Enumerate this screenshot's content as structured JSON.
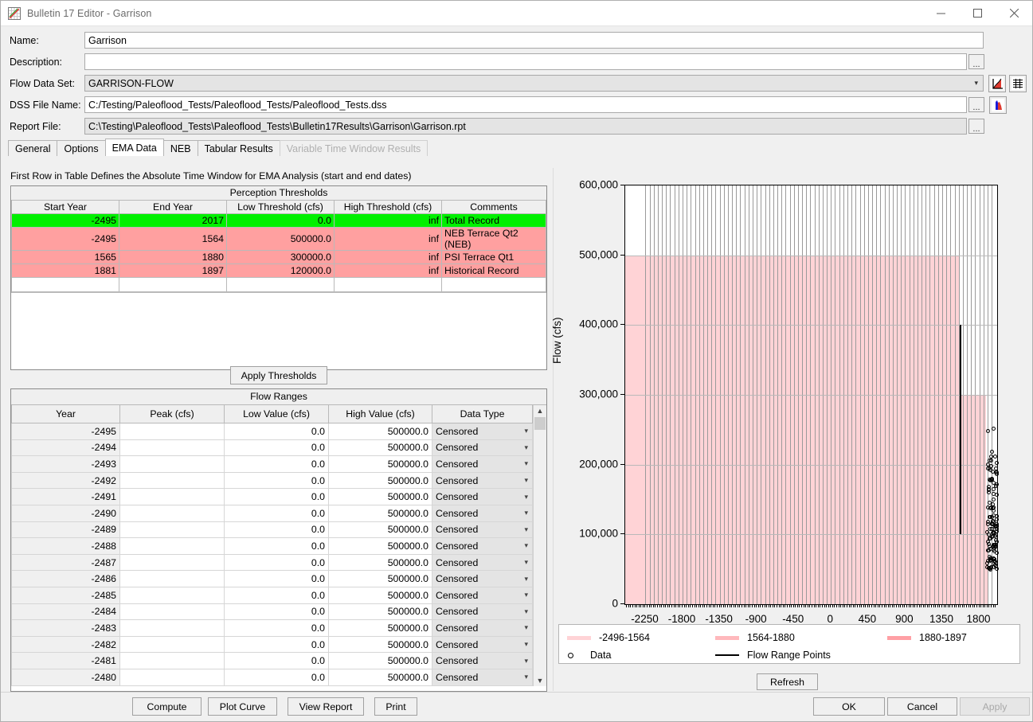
{
  "window": {
    "title": "Bulletin 17 Editor - Garrison",
    "icon": "bulletin-chart-icon",
    "minimize": "minimize-icon",
    "maximize": "maximize-icon",
    "close": "close-icon"
  },
  "form": {
    "name_label": "Name:",
    "name_value": "Garrison",
    "description_label": "Description:",
    "description_value": "",
    "flow_data_set_label": "Flow Data Set:",
    "flow_data_set_value": "GARRISON-FLOW",
    "dss_file_label": "DSS File Name:",
    "dss_file_value": "C:/Testing/Paleoflood_Tests/Paleoflood_Tests/Paleoflood_Tests.dss",
    "report_file_label": "Report File:",
    "report_file_value": "C:\\Testing\\Paleoflood_Tests\\Paleoflood_Tests\\Bulletin17Results\\Garrison\\Garrison.rpt",
    "ellipsis": "...",
    "icons": {
      "plot": "line-plot-icon",
      "table": "table-icon",
      "histogram": "histogram-icon"
    }
  },
  "tabs": [
    {
      "label": "General",
      "active": false,
      "disabled": false
    },
    {
      "label": "Options",
      "active": false,
      "disabled": false
    },
    {
      "label": "EMA Data",
      "active": true,
      "disabled": false
    },
    {
      "label": "NEB",
      "active": false,
      "disabled": false
    },
    {
      "label": "Tabular Results",
      "active": false,
      "disabled": false
    },
    {
      "label": "Variable Time Window Results",
      "active": false,
      "disabled": true
    }
  ],
  "hint": "First Row in Table Defines the Absolute Time Window for EMA Analysis (start and end dates)",
  "perception_thresholds": {
    "caption": "Perception Thresholds",
    "columns": [
      "Start Year",
      "End Year",
      "Low Threshold (cfs)",
      "High Threshold (cfs)",
      "Comments"
    ],
    "rows": [
      {
        "start": "-2495",
        "end": "2017",
        "low": "0.0",
        "high": "inf",
        "comment": "Total Record",
        "style": "green"
      },
      {
        "start": "-2495",
        "end": "1564",
        "low": "500000.0",
        "high": "inf",
        "comment": "NEB Terrace Qt2 (NEB)",
        "style": "pink"
      },
      {
        "start": "1565",
        "end": "1880",
        "low": "300000.0",
        "high": "inf",
        "comment": "PSI Terrace Qt1",
        "style": "pink"
      },
      {
        "start": "1881",
        "end": "1897",
        "low": "120000.0",
        "high": "inf",
        "comment": "Historical Record",
        "style": "pink"
      },
      {
        "start": "",
        "end": "",
        "low": "",
        "high": "",
        "comment": "",
        "style": "empty"
      }
    ]
  },
  "apply_thresholds_label": "Apply Thresholds",
  "flow_ranges": {
    "caption": "Flow Ranges",
    "columns": [
      "Year",
      "Peak (cfs)",
      "Low Value (cfs)",
      "High Value (cfs)",
      "Data Type"
    ],
    "rows": [
      {
        "year": "-2495",
        "peak": "",
        "low": "0.0",
        "high": "500000.0",
        "type": "Censored"
      },
      {
        "year": "-2494",
        "peak": "",
        "low": "0.0",
        "high": "500000.0",
        "type": "Censored"
      },
      {
        "year": "-2493",
        "peak": "",
        "low": "0.0",
        "high": "500000.0",
        "type": "Censored"
      },
      {
        "year": "-2492",
        "peak": "",
        "low": "0.0",
        "high": "500000.0",
        "type": "Censored"
      },
      {
        "year": "-2491",
        "peak": "",
        "low": "0.0",
        "high": "500000.0",
        "type": "Censored"
      },
      {
        "year": "-2490",
        "peak": "",
        "low": "0.0",
        "high": "500000.0",
        "type": "Censored"
      },
      {
        "year": "-2489",
        "peak": "",
        "low": "0.0",
        "high": "500000.0",
        "type": "Censored"
      },
      {
        "year": "-2488",
        "peak": "",
        "low": "0.0",
        "high": "500000.0",
        "type": "Censored"
      },
      {
        "year": "-2487",
        "peak": "",
        "low": "0.0",
        "high": "500000.0",
        "type": "Censored"
      },
      {
        "year": "-2486",
        "peak": "",
        "low": "0.0",
        "high": "500000.0",
        "type": "Censored"
      },
      {
        "year": "-2485",
        "peak": "",
        "low": "0.0",
        "high": "500000.0",
        "type": "Censored"
      },
      {
        "year": "-2484",
        "peak": "",
        "low": "0.0",
        "high": "500000.0",
        "type": "Censored"
      },
      {
        "year": "-2483",
        "peak": "",
        "low": "0.0",
        "high": "500000.0",
        "type": "Censored"
      },
      {
        "year": "-2482",
        "peak": "",
        "low": "0.0",
        "high": "500000.0",
        "type": "Censored"
      },
      {
        "year": "-2481",
        "peak": "",
        "low": "0.0",
        "high": "500000.0",
        "type": "Censored"
      },
      {
        "year": "-2480",
        "peak": "",
        "low": "0.0",
        "high": "500000.0",
        "type": "Censored"
      }
    ]
  },
  "chart_data": {
    "type": "area",
    "title": "",
    "xlabel": "",
    "ylabel": "Flow (cfs)",
    "xlim": [
      -2496,
      2017
    ],
    "ylim": [
      0,
      600000
    ],
    "xticks": [
      -2250,
      -1800,
      -1350,
      -900,
      -450,
      0,
      450,
      900,
      1350,
      1800
    ],
    "yticks": [
      0,
      100000,
      200000,
      300000,
      400000,
      500000,
      600000
    ],
    "ytick_labels": [
      "0",
      "100,000",
      "200,000",
      "300,000",
      "400,000",
      "500,000",
      "600,000"
    ],
    "grid": true,
    "legend_position": "bottom",
    "series": [
      {
        "name": "-2496-1564",
        "type": "band",
        "color": "#ffd3d6",
        "x_start": -2496,
        "x_end": 1564,
        "y_low": 0,
        "y_high": 500000
      },
      {
        "name": "1564-1880",
        "type": "band",
        "color": "#ffd3d6",
        "x_start": 1564,
        "x_end": 1880,
        "y_low": 0,
        "y_high": 300000
      },
      {
        "name": "1880-1897",
        "type": "band",
        "color": "#ffd3d6",
        "x_start": 1880,
        "x_end": 1897,
        "y_low": 0,
        "y_high": 120000
      },
      {
        "name": "Flow Range Points",
        "type": "line",
        "color": "#000000",
        "x": 1564,
        "y_low": 100000,
        "y_high": 400000
      },
      {
        "name": "Data",
        "type": "scatter",
        "color": "#000000",
        "marker": "circle",
        "x_range": [
          1898,
          2017
        ],
        "y_range": [
          50000,
          255000
        ],
        "count": 120
      }
    ]
  },
  "legend": {
    "items": [
      {
        "label": "-2496-1564",
        "kind": "band",
        "color": "#ffd3d6"
      },
      {
        "label": "1564-1880",
        "kind": "band",
        "color": "#ffb8bc"
      },
      {
        "label": "1880-1897",
        "kind": "band",
        "color": "#ffa0a5"
      },
      {
        "label": "Data",
        "kind": "circle",
        "color": "#000000"
      },
      {
        "label": "Flow Range Points",
        "kind": "line",
        "color": "#000000"
      }
    ]
  },
  "refresh_label": "Refresh",
  "bottom_buttons": [
    {
      "label": "Compute",
      "disabled": false
    },
    {
      "label": "Plot Curve",
      "disabled": false
    },
    {
      "label": "View Report",
      "disabled": false
    },
    {
      "label": "Print",
      "disabled": false
    },
    {
      "label": "OK",
      "disabled": false
    },
    {
      "label": "Cancel",
      "disabled": false
    },
    {
      "label": "Apply",
      "disabled": true
    }
  ]
}
